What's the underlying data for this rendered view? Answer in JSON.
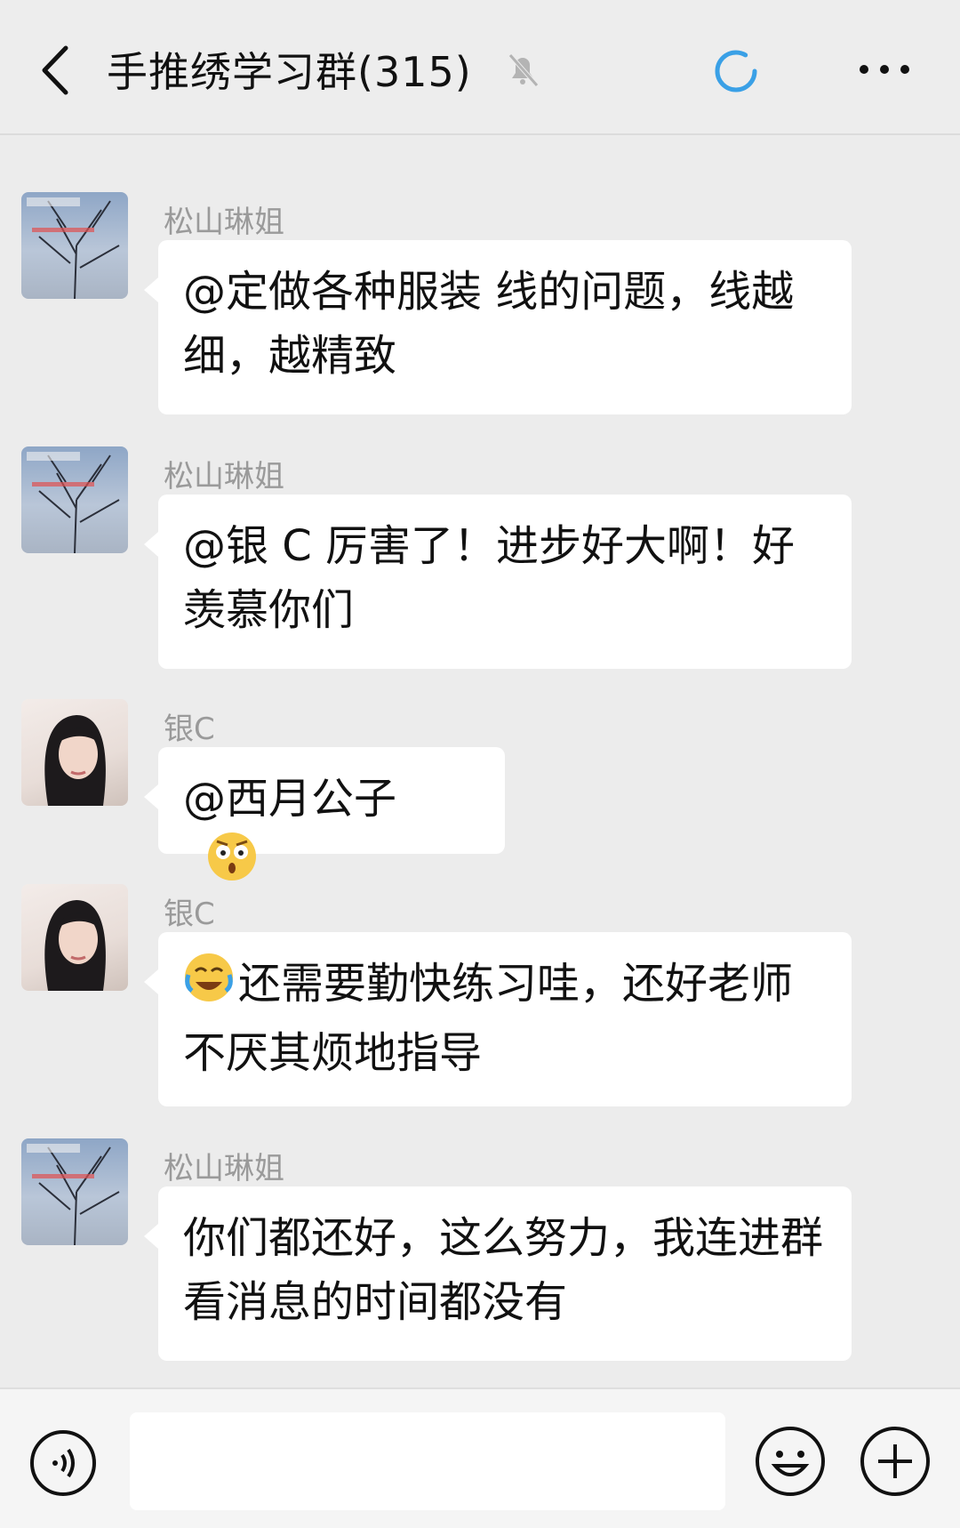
{
  "header": {
    "title": "手推绣学习群(315)",
    "icons": {
      "back": "chevron-left-icon",
      "mute": "muted-bell-icon",
      "loading": "loading-spinner-icon",
      "more": "more-dots-icon"
    }
  },
  "messages": [
    {
      "sender": "松山琳姐",
      "avatar": "tree-avatar",
      "text": "@定做各种服装  线的问题，线越细，越精致"
    },
    {
      "sender": "松山琳姐",
      "avatar": "tree-avatar",
      "text": "@银 C  厉害了！进步好大啊！好羡慕你们"
    },
    {
      "sender": "银C",
      "avatar": "girl-avatar",
      "text": "@西月公子",
      "emoji_after": "surprised-emoji"
    },
    {
      "sender": "银C",
      "avatar": "girl-avatar",
      "emoji_before": "laugh-cry-emoji",
      "text": "还需要勤快练习哇，还好老师不厌其烦地指导"
    },
    {
      "sender": "松山琳姐",
      "avatar": "tree-avatar",
      "text": "你们都还好，这么努力，我连进群看消息的时间都没有"
    }
  ],
  "composer": {
    "icons": {
      "voice": "voice-icon",
      "emoji": "emoji-icon",
      "plus": "plus-icon"
    }
  },
  "colors": {
    "accent": "#3aa0e6",
    "bubble": "#ffffff",
    "background": "#ececec"
  }
}
